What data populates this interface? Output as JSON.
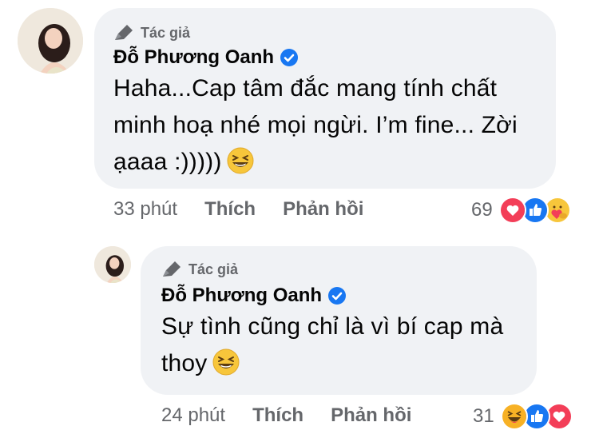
{
  "comments": [
    {
      "badge": "Tác giả",
      "author": "Đỗ Phương Oanh",
      "lines": [
        "Haha...Cap tâm đắc mang tính chất",
        "minh hoạ nhé mọi ngừi. I’m fine... Zời",
        "ạaaa :)))))"
      ],
      "time": "33 phút",
      "like": "Thích",
      "reply": "Phản hồi",
      "reaction_count": "69",
      "reactions": [
        "heart-icon",
        "like-icon",
        "care-icon"
      ]
    },
    {
      "badge": "Tác giả",
      "author": "Đỗ Phương Oanh",
      "lines": [
        "Sự tình cũng chỉ là vì bí cap mà",
        "thoy"
      ],
      "time": "24 phút",
      "like": "Thích",
      "reply": "Phản hồi",
      "reaction_count": "31",
      "reactions": [
        "haha-icon",
        "like-icon",
        "heart-icon"
      ]
    }
  ],
  "colors": {
    "bubble": "#f0f2f5",
    "meta": "#65676b",
    "verified": "#1877f2",
    "heart": "#f33e58",
    "like": "#1877f2",
    "haha": "#f7b125"
  }
}
